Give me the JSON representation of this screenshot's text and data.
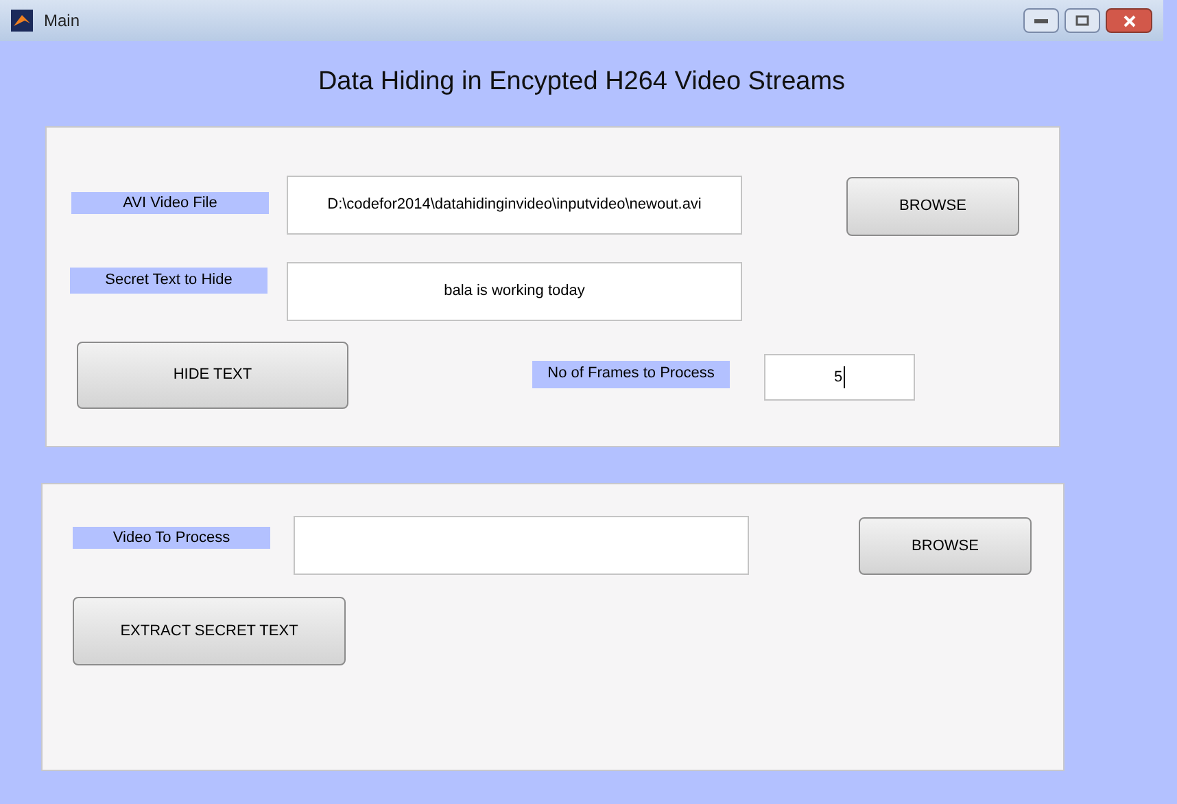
{
  "window": {
    "title": "Main"
  },
  "heading": "Data Hiding in Encypted H264 Video Streams",
  "hide_panel": {
    "video_label": "AVI Video File",
    "video_path": "D:\\codefor2014\\datahidinginvideo\\inputvideo\\newout.avi",
    "browse_button": "BROWSE",
    "secret_label": "Secret Text to Hide",
    "secret_text": "bala is working today",
    "hide_button": "HIDE TEXT",
    "frames_label": "No of Frames to Process",
    "frames_value": "5"
  },
  "extract_panel": {
    "video_label": "Video To Process",
    "browse_button": "BROWSE",
    "extract_button": "EXTRACT SECRET TEXT"
  }
}
